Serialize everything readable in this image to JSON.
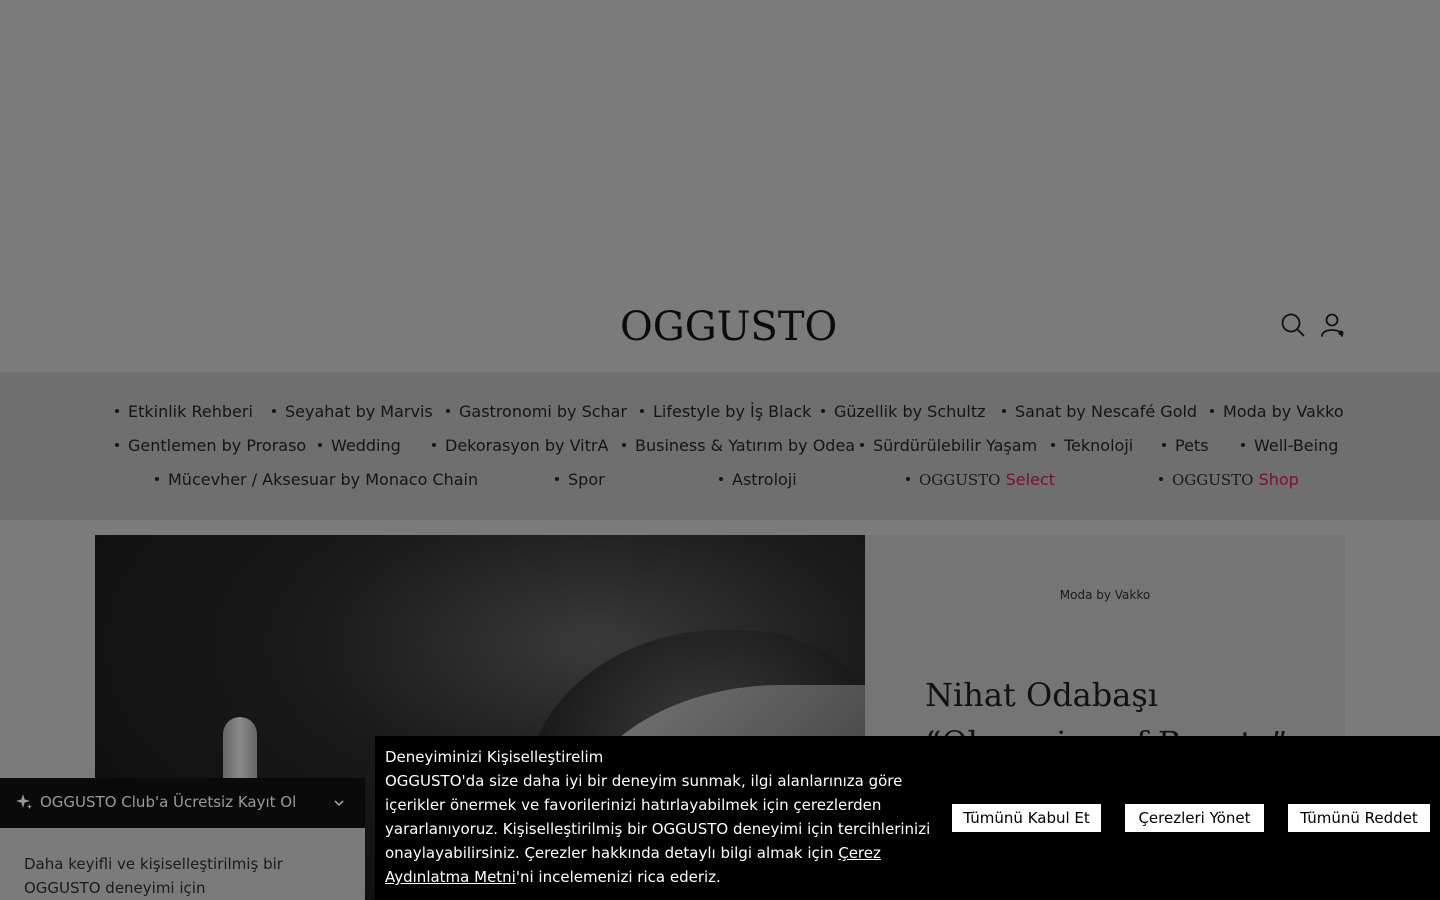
{
  "header": {
    "logo": "OGGUSTO",
    "search_icon": "search-icon",
    "user_icon": "user-icon"
  },
  "nav": {
    "items": [
      {
        "label": "Etkinlik Rehberi"
      },
      {
        "label": "Seyahat by Marvis"
      },
      {
        "label": "Gastronomi by Schar"
      },
      {
        "label": "Lifestyle by İş Black"
      },
      {
        "label": "Güzellik by Schultz"
      },
      {
        "label": "Sanat by Nescafé Gold"
      },
      {
        "label": "Moda by Vakko"
      },
      {
        "label": "Gentlemen by Proraso"
      },
      {
        "label": "Wedding"
      },
      {
        "label": "Dekorasyon by VitrA"
      },
      {
        "label": "Business & Yatırım by Odea"
      },
      {
        "label": "Sürdürülebilir Yaşam"
      },
      {
        "label": "Teknoloji"
      },
      {
        "label": "Pets"
      },
      {
        "label": "Well-Being"
      },
      {
        "label": "Mücevher / Aksesuar by Monaco Chain"
      },
      {
        "label": "Spor"
      },
      {
        "label": "Astroloji"
      }
    ],
    "select": {
      "brand": "OGGUSTO",
      "label": "Select"
    },
    "shop": {
      "brand": "OGGUSTO",
      "label": "Shop"
    }
  },
  "article": {
    "category": "Moda by Vakko",
    "title": "Nihat Odabaşı “Obsession of Beauty” Sergisini Anlattı"
  },
  "club": {
    "label": "OGGUSTO Club'a Ücretsiz Kayıt Ol",
    "description": "Daha keyifli ve kişiselleştirilmiş bir OGGUSTO deneyimi için"
  },
  "cookie": {
    "heading": "Deneyiminizi Kişiselleştirelim",
    "body_1": "OGGUSTO'da size daha iyi bir deneyim sunmak, ilgi alanlarınıza göre içerikler önermek ve favorilerinizi hatırlayabilmek için çerezlerden yararlanıyoruz. Kişiselleştirilmiş bir OGGUSTO deneyimi için tercihlerinizi onaylayabilirsiniz. Çerezler hakkında detaylı bilgi almak için ",
    "link": "Çerez Aydınlatma Metni",
    "body_2": "'ni incelemenizi rica ederiz.",
    "accept_label": "Tümünü Kabul Et",
    "manage_label": "Çerezleri Yönet",
    "reject_label": "Tümünü Reddet"
  },
  "colors": {
    "overlay_gray": "#7b7b7b",
    "nav_gray": "#6f6f6f",
    "accent": "#7a0f33",
    "cookie_bg": "#000000"
  }
}
